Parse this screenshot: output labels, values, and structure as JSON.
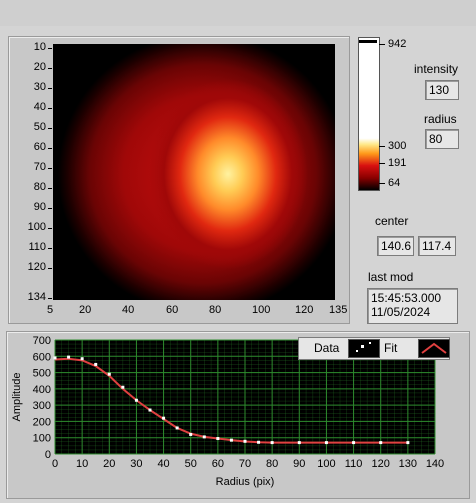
{
  "image_display": {
    "y_ticks": [
      "10",
      "20",
      "30",
      "40",
      "50",
      "60",
      "70",
      "80",
      "90",
      "100",
      "110",
      "120",
      "134"
    ],
    "x_ticks": [
      "5",
      "20",
      "40",
      "60",
      "80",
      "100",
      "120",
      "135"
    ]
  },
  "colorbar": {
    "labels": [
      "942",
      "300",
      "191",
      "64"
    ]
  },
  "intensity": {
    "label": "intensity",
    "value": "130"
  },
  "radius": {
    "label": "radius",
    "value": "80"
  },
  "center": {
    "label": "center",
    "x": "140.6",
    "y": "117.4"
  },
  "last_mod": {
    "label": "last mod",
    "time": "15:45:53.000",
    "date": "11/05/2024"
  },
  "plot": {
    "legend": {
      "data_label": "Data",
      "fit_label": "Fit"
    },
    "colors": {
      "data": "#ffffff",
      "fit": "#e04040",
      "grid": "#2e8b2e",
      "background": "#000000"
    }
  },
  "chart_data": {
    "type": "line",
    "xlabel": "Radius (pix)",
    "ylabel": "Amplitude",
    "xlim": [
      0,
      140
    ],
    "ylim": [
      0,
      700
    ],
    "x_ticks": [
      "0",
      "10",
      "20",
      "30",
      "40",
      "50",
      "60",
      "70",
      "80",
      "90",
      "100",
      "110",
      "120",
      "130",
      "140"
    ],
    "y_ticks": [
      "700",
      "600",
      "500",
      "400",
      "300",
      "200",
      "100",
      "0"
    ],
    "series": [
      {
        "name": "Data",
        "x": [
          0,
          5,
          10,
          15,
          20,
          25,
          30,
          35,
          40,
          45,
          50,
          55,
          60,
          65,
          70,
          75,
          80,
          90,
          100,
          110,
          120,
          130
        ],
        "y": [
          590,
          595,
          585,
          550,
          490,
          410,
          330,
          270,
          220,
          160,
          120,
          105,
          95,
          85,
          78,
          72,
          70,
          70,
          70,
          70,
          70,
          70
        ]
      },
      {
        "name": "Fit",
        "x": [
          0,
          5,
          10,
          15,
          20,
          25,
          30,
          35,
          40,
          45,
          50,
          55,
          60,
          65,
          70,
          75,
          80,
          90,
          100,
          110,
          120,
          130
        ],
        "y": [
          580,
          585,
          575,
          540,
          480,
          400,
          330,
          270,
          215,
          160,
          125,
          105,
          95,
          85,
          77,
          72,
          70,
          70,
          70,
          70,
          70,
          70
        ]
      }
    ]
  }
}
